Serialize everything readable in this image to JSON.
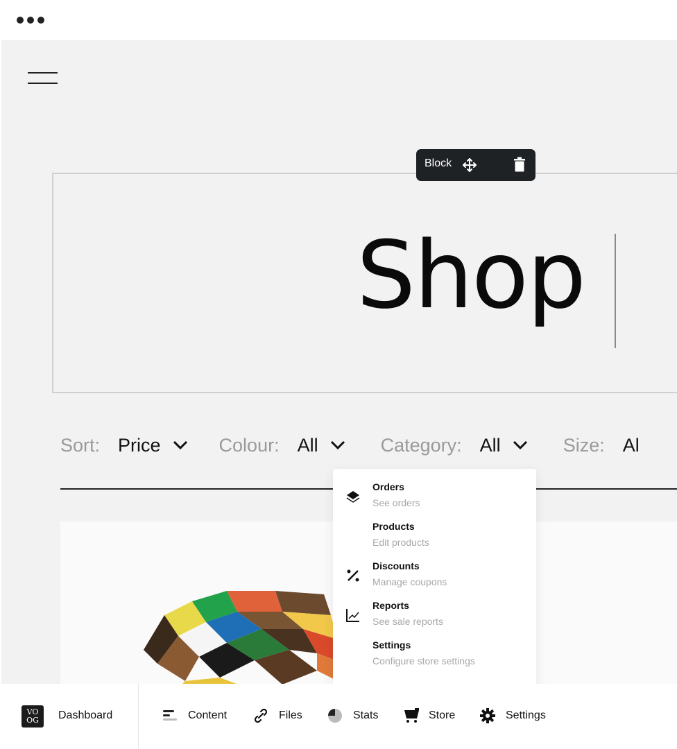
{
  "window": {
    "menu_icon": "more-dots-icon"
  },
  "header": {
    "menu_icon": "hamburger-icon"
  },
  "block_toolbar": {
    "label": "Block",
    "move_icon": "move-arrows-icon",
    "delete_icon": "trash-icon"
  },
  "page": {
    "title": "Shop"
  },
  "filters": [
    {
      "label": "Sort:",
      "value": "Price"
    },
    {
      "label": "Colour:",
      "value": "All"
    },
    {
      "label": "Category:",
      "value": "All"
    },
    {
      "label": "Size:",
      "value": "Al"
    }
  ],
  "store_menu": {
    "items": [
      {
        "title": "Orders",
        "subtitle": "See orders",
        "icon": "layers-icon"
      },
      {
        "title": "Products",
        "subtitle": "Edit products",
        "icon": ""
      },
      {
        "title": "Discounts",
        "subtitle": "Manage coupons",
        "icon": "percent-icon"
      },
      {
        "title": "Reports",
        "subtitle": "See sale reports",
        "icon": "chart-line-icon"
      },
      {
        "title": "Settings",
        "subtitle": "Configure store settings",
        "icon": ""
      }
    ]
  },
  "bottom_nav": {
    "logo_text": "VO OG",
    "dashboard": "Dashboard",
    "items": [
      {
        "label": "Content",
        "icon": "content-lines-icon"
      },
      {
        "label": "Files",
        "icon": "paperclip-icon"
      },
      {
        "label": "Stats",
        "icon": "pie-chart-icon"
      },
      {
        "label": "Store",
        "icon": "cart-icon"
      },
      {
        "label": "Settings",
        "icon": "gear-icon"
      }
    ]
  },
  "colors": {
    "toolbar_bg": "#1f2225",
    "canvas_bg": "#f2f2f2",
    "muted_text": "#9a9a9a"
  }
}
